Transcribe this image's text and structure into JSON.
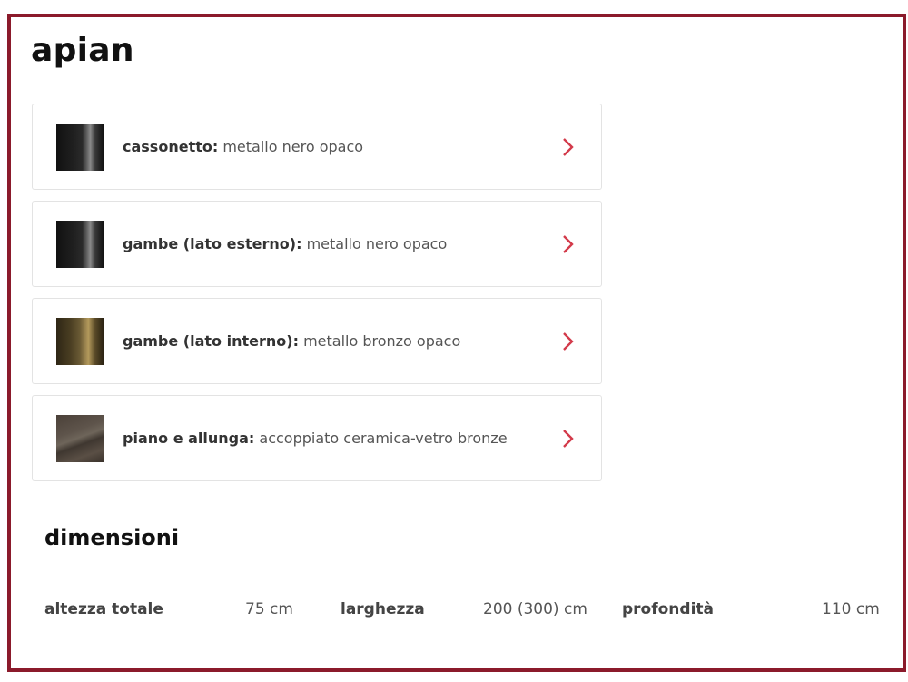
{
  "product": {
    "title": "apian"
  },
  "options": [
    {
      "label": "cassonetto:",
      "value": "metallo nero opaco",
      "swatch": "black-metal-swatch"
    },
    {
      "label": "gambe (lato esterno):",
      "value": "metallo nero opaco",
      "swatch": "black-metal-swatch"
    },
    {
      "label": "gambe (lato interno):",
      "value": "metallo bronzo opaco",
      "swatch": "bronze-metal-swatch"
    },
    {
      "label": "piano e allunga:",
      "value": "accoppiato ceramica-vetro bronze",
      "swatch": "ceramic-glass-swatch"
    }
  ],
  "dimensions": {
    "title": "dimensioni",
    "items": [
      {
        "label": "altezza totale",
        "value": "75 cm"
      },
      {
        "label": "larghezza",
        "value": "200 (300) cm"
      },
      {
        "label": "profondità",
        "value": "110 cm"
      }
    ]
  },
  "colors": {
    "frame": "#8b1a2b",
    "chevron": "#d33a4a"
  },
  "icons": {
    "chevron": "chevron-right-icon"
  }
}
